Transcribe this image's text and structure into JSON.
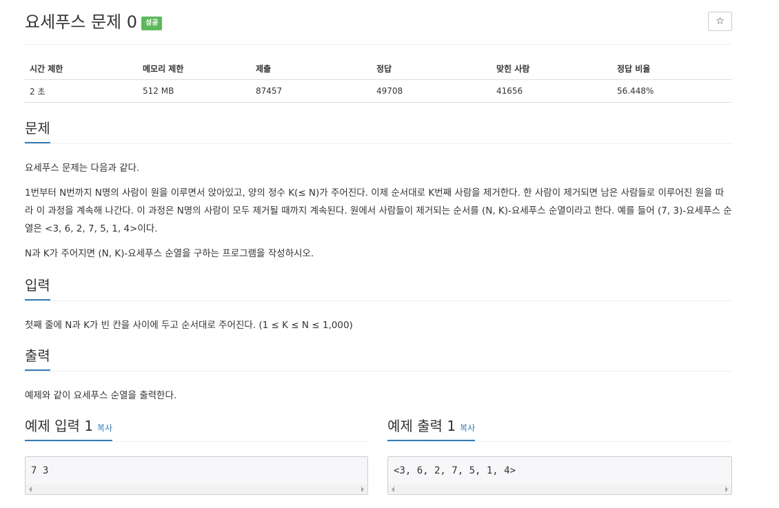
{
  "problem": {
    "title": "요세푸스 문제 0",
    "badge": "성공",
    "star_icon": "☆"
  },
  "stats": {
    "headers": [
      "시간 제한",
      "메모리 제한",
      "제출",
      "정답",
      "맞힌 사람",
      "정답 비율"
    ],
    "values": [
      "2 초",
      "512 MB",
      "87457",
      "49708",
      "41656",
      "56.448%"
    ]
  },
  "description": {
    "heading": "문제",
    "paragraphs": [
      "요세푸스 문제는 다음과 같다.",
      "1번부터 N번까지 N명의 사람이 원을 이루면서 앉아있고, 양의 정수 K(≤ N)가 주어진다. 이제 순서대로 K번째 사람을 제거한다. 한 사람이 제거되면 남은 사람들로 이루어진 원을 따라 이 과정을 계속해 나간다. 이 과정은 N명의 사람이 모두 제거될 때까지 계속된다. 원에서 사람들이 제거되는 순서를 (N, K)-요세푸스 순열이라고 한다. 예를 들어 (7, 3)-요세푸스 순열은 <3, 6, 2, 7, 5, 1, 4>이다.",
      "N과 K가 주어지면 (N, K)-요세푸스 순열을 구하는 프로그램을 작성하시오."
    ]
  },
  "input": {
    "heading": "입력",
    "text": "첫째 줄에 N과 K가 빈 칸을 사이에 두고 순서대로 주어진다. (1 ≤ K ≤ N ≤ 1,000)"
  },
  "output": {
    "heading": "출력",
    "text": "예제와 같이 요세푸스 순열을 출력한다."
  },
  "samples": {
    "input_heading": "예제 입력 1",
    "output_heading": "예제 출력 1",
    "copy_label": "복사",
    "input_value": "7 3",
    "output_value": "<3, 6, 2, 7, 5, 1, 4>"
  },
  "colors": {
    "accent": "#337ab7",
    "success": "#5cb85c"
  }
}
